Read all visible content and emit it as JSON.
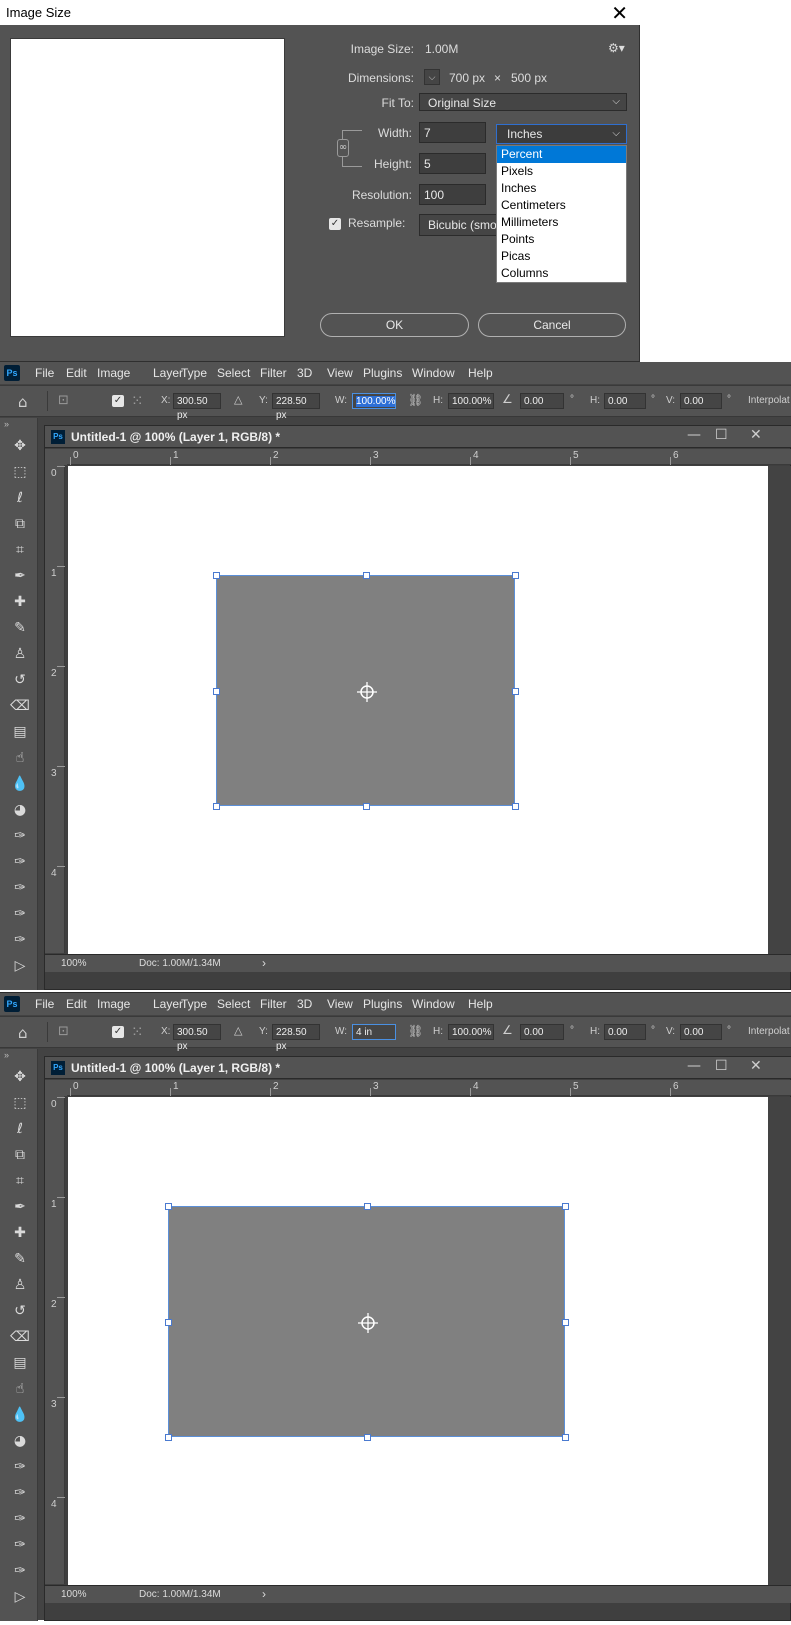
{
  "dialog": {
    "title": "Image Size",
    "close_label": "✕",
    "image_size_label": "Image Size:",
    "image_size_value": "1.00M",
    "dimensions_label": "Dimensions:",
    "dimensions_width": "700 px",
    "dimensions_times": "×",
    "dimensions_height": "500 px",
    "fit_to_label": "Fit To:",
    "fit_to_value": "Original Size",
    "width_label": "Width:",
    "width_value": "7",
    "height_label": "Height:",
    "height_value": "5",
    "resolution_label": "Resolution:",
    "resolution_value": "100",
    "resample_label": "Resample:",
    "resample_value": "Bicubic (smo",
    "unit_value": "Inches",
    "unit_options": [
      "Percent",
      "Pixels",
      "Inches",
      "Centimeters",
      "Millimeters",
      "Points",
      "Picas",
      "Columns"
    ],
    "unit_selected_option": "Percent",
    "ok_label": "OK",
    "cancel_label": "Cancel"
  },
  "menu": [
    "File",
    "Edit",
    "Image",
    "Layer",
    "Type",
    "Select",
    "Filter",
    "3D",
    "View",
    "Plugins",
    "Window",
    "Help"
  ],
  "ps_logo": "Ps",
  "options": {
    "x_label": "X:",
    "x_value": "300.50 px",
    "y_label": "Y:",
    "y_value": "228.50 px",
    "w_label": "W:",
    "h_label": "H:",
    "h_value": "100.00%",
    "angle_value": "0.00",
    "deg": "°",
    "skew_h_label": "H:",
    "skew_h_value": "0.00",
    "skew_v_label": "V:",
    "skew_v_value": "0.00",
    "interpolation_label": "Interpolat"
  },
  "windows": [
    {
      "w_value": "100.00%"
    },
    {
      "w_value": "4 in"
    }
  ],
  "document": {
    "title": "Untitled-1 @ 100% (Layer 1, RGB/8) *",
    "zoom": "100%",
    "doc_size": "Doc: 1.00M/1.34M",
    "ruler_h": [
      "0",
      "1",
      "2",
      "3",
      "4",
      "5",
      "6"
    ],
    "ruler_v": [
      "0",
      "1",
      "2",
      "3",
      "4"
    ]
  }
}
